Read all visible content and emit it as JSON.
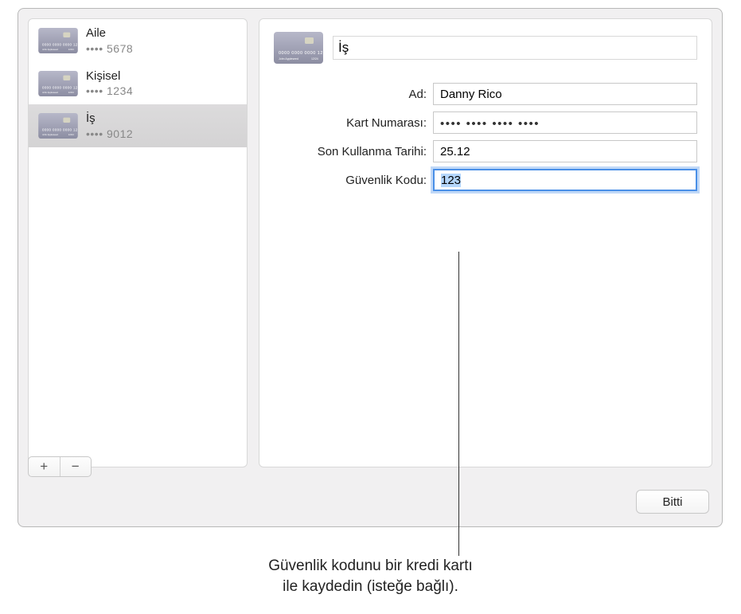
{
  "cards": [
    {
      "name": "Aile",
      "masked": "•••• 5678"
    },
    {
      "name": "Kişisel",
      "masked": "•••• 1234"
    },
    {
      "name": "İş",
      "masked": "•••• 9012"
    }
  ],
  "selected_index": 2,
  "detail": {
    "title_value": "İş",
    "labels": {
      "name": "Ad:",
      "number": "Kart Numarası:",
      "expiry": "Son Kullanma Tarihi:",
      "security": "Güvenlik Kodu:"
    },
    "values": {
      "name": "Danny Rico",
      "number_masked": "•••• •••• •••• ••••",
      "expiry": "25.12",
      "security": "123"
    }
  },
  "buttons": {
    "add": "+",
    "remove": "−",
    "done": "Bitti"
  },
  "callout": "Güvenlik kodunu bir kredi kartı\nile kaydedin (isteğe bağlı).",
  "card_art": {
    "bg_top": "#b7b8c9",
    "bg_bottom": "#8c8da2",
    "chip": "#d6d4c2",
    "text": "#ffffff"
  }
}
